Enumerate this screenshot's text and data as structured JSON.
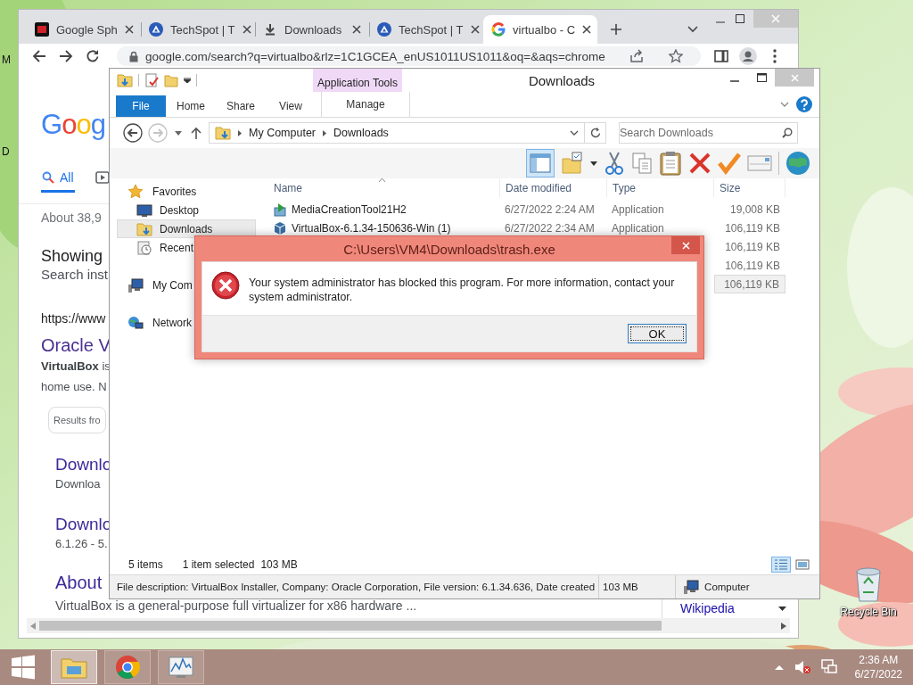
{
  "desktop": {
    "icon_labels": [
      "M",
      "D"
    ],
    "recycle_bin": {
      "label": "Recycle Bin"
    }
  },
  "browser": {
    "tabs": [
      {
        "kind": "mr",
        "title": "Google Sph",
        "selected": false
      },
      {
        "kind": "techspot",
        "title": "TechSpot | T",
        "selected": false
      },
      {
        "kind": "download",
        "title": "Downloads",
        "selected": false
      },
      {
        "kind": "techspot",
        "title": "TechSpot | T",
        "selected": false
      },
      {
        "kind": "google",
        "title": "virtualbo - C",
        "selected": true
      }
    ],
    "address": "google.com/search?q=virtualbo&rlz=1C1GCEA_enUS1011US1011&oq=&aqs=chrome",
    "page": {
      "logo": "Goog",
      "search_tabs": [
        {
          "kind": "all",
          "label": "All",
          "selected": true
        },
        {
          "kind": "video",
          "selected": false
        }
      ],
      "result_count": "About 38,9",
      "showing": "Showing",
      "search_instead": "Search inst",
      "result": {
        "url": "https://www",
        "title": "Oracle V",
        "snippet": [
          "**VirtualBox** is",
          "home use. N"
        ],
        "chip": "Results fro",
        "sublinks": [
          {
            "title": "Downlo",
            "text": "Downloa"
          },
          {
            "title": "Downlo",
            "text": "6.1.26 - 5."
          }
        ]
      },
      "about": {
        "title": "About",
        "text": "VirtualBox is a general-purpose full virtualizer for x86 hardware ...",
        "source": "Wikipedia"
      }
    }
  },
  "explorer": {
    "title": "Downloads",
    "context_tab": "Application Tools",
    "ribbon_tabs": [
      {
        "kind": "menu",
        "label": "File"
      },
      {
        "kind": "tab",
        "label": "Home"
      },
      {
        "kind": "tab",
        "label": "Share"
      },
      {
        "kind": "tab",
        "label": "View"
      },
      {
        "kind": "context",
        "label": "Manage"
      }
    ],
    "nav_buttons": [
      {
        "kind": "back",
        "disabled": false
      },
      {
        "kind": "forward",
        "disabled": true
      }
    ],
    "breadcrumb": [
      "My Computer",
      "Downloads"
    ],
    "search": {
      "placeholder": "Search Downloads"
    },
    "toolbar": [
      {
        "kind": "pane",
        "selected": true
      },
      {
        "kind": "folder-check",
        "selected": false
      },
      {
        "kind": "cut",
        "selected": false
      },
      {
        "kind": "copy",
        "selected": false
      },
      {
        "kind": "paste",
        "selected": false
      },
      {
        "kind": "delete",
        "selected": false
      },
      {
        "kind": "check",
        "selected": false
      },
      {
        "kind": "rename",
        "selected": false
      },
      {
        "kind": "globe",
        "selected": false
      }
    ],
    "nav": [
      {
        "kind": "favorites",
        "label": "Favorites",
        "selected": false,
        "children": [
          {
            "kind": "desktop",
            "label": "Desktop",
            "selected": false
          },
          {
            "kind": "downloads",
            "label": "Downloads",
            "selected": true
          },
          {
            "kind": "recent",
            "label": "Recent",
            "selected": false
          }
        ]
      },
      {
        "kind": "computer",
        "label": "My Com",
        "selected": false
      },
      {
        "kind": "network",
        "label": "Network",
        "selected": false
      }
    ],
    "columns": [
      "Name",
      "Date modified",
      "Type",
      "Size"
    ],
    "rows": [
      {
        "kind": "installer",
        "name": "MediaCreationTool21H2",
        "date": "6/27/2022 2:24 AM",
        "type": "Application",
        "size": "19,008 KB",
        "selected": false
      },
      {
        "kind": "cube",
        "name": "VirtualBox-6.1.34-150636-Win (1)",
        "date": "6/27/2022 2:34 AM",
        "type": "Application",
        "size": "106,119 KB",
        "selected": false
      },
      {
        "size": "106,119 KB",
        "selected": false
      },
      {
        "size": "106,119 KB",
        "selected": false
      },
      {
        "size": "106,119 KB",
        "selected": true
      }
    ],
    "status": {
      "items": "5 items",
      "selected": "1 item selected",
      "selected_size": "103 MB"
    },
    "view_buttons": [
      {
        "kind": "details",
        "selected": true
      },
      {
        "kind": "thumbnails",
        "selected": false
      }
    ],
    "details": {
      "description": "File description: VirtualBox Installer, Company: Oracle Corporation, File version: 6.1.34.636, Date created",
      "size": "103 MB",
      "zone": "Computer"
    }
  },
  "dialog": {
    "title": "C:\\Users\\VM4\\Downloads\\trash.exe",
    "message": "Your system administrator has blocked this program. For more information, contact your system administrator.",
    "button": "OK"
  },
  "taskbar": {
    "apps": [
      {
        "kind": "explorer",
        "selected": true
      },
      {
        "kind": "chrome",
        "selected": false
      },
      {
        "kind": "monitor",
        "selected": false
      }
    ],
    "time": "2:36 AM",
    "date": "6/27/2022"
  }
}
